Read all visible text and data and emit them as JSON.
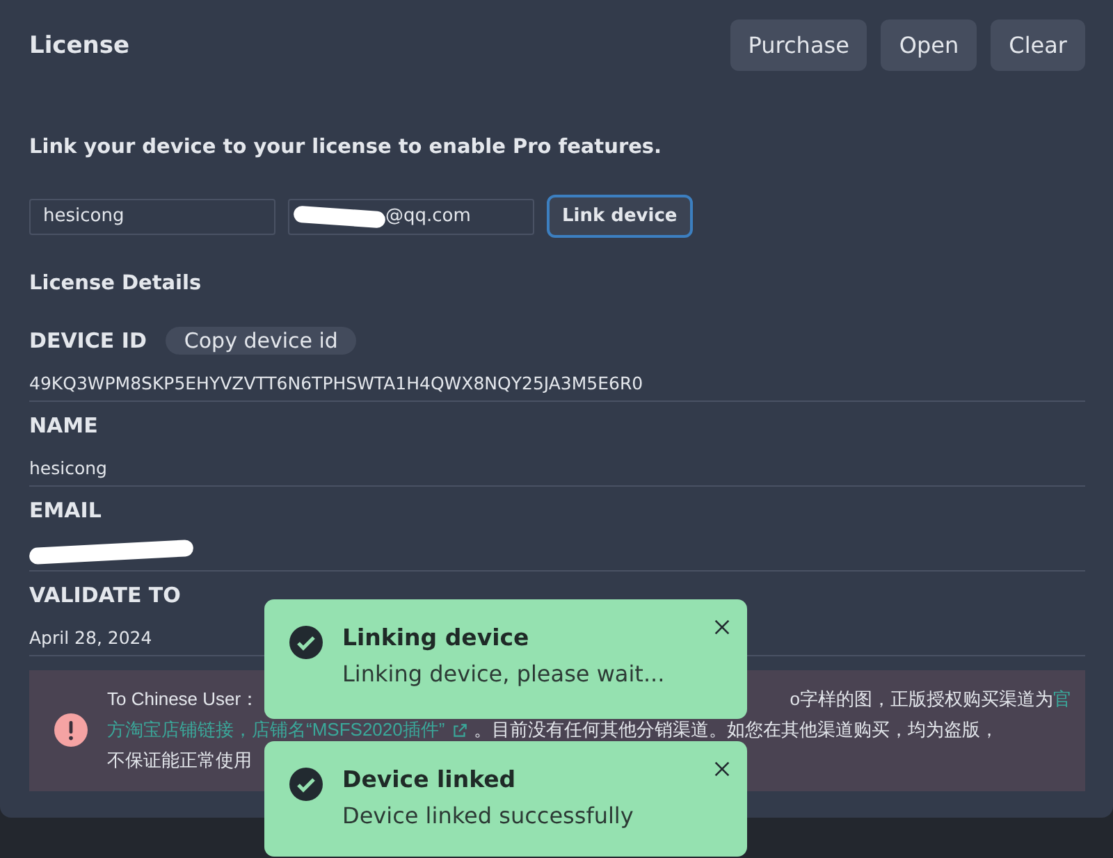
{
  "header": {
    "title": "License",
    "buttons": [
      "Purchase",
      "Open",
      "Clear"
    ]
  },
  "link_form": {
    "prompt": "Link your device to your license to enable Pro features.",
    "name_field": {
      "value": "hesicong"
    },
    "email_field": {
      "value": "@qq.com",
      "redacted": true
    },
    "button": {
      "label": "Link device",
      "focused": true
    }
  },
  "details": {
    "title": "License Details",
    "rows": [
      {
        "label": "DEVICE ID",
        "action": "Copy device id",
        "value": "49KQ3WPM8SKP5EHYVZVTT6N6TPHSWTA1H4QWX8NQY25JA3M5E6R0",
        "redacted": false
      },
      {
        "label": "NAME",
        "value": "hesicong",
        "redacted": false
      },
      {
        "label": "EMAIL",
        "redacted": true
      },
      {
        "label": "VALIDATE TO",
        "value": "April 28, 2024",
        "redacted": false
      }
    ]
  },
  "alert": {
    "lines": [
      {
        "left": [
          {
            "kind": "text",
            "text": "To Chinese User："
          }
        ],
        "right": [
          {
            "kind": "text",
            "text": "o字样的图，正版授权购买渠道为"
          },
          {
            "kind": "link",
            "text": "官"
          }
        ]
      },
      {
        "left": [
          {
            "kind": "link_external",
            "text": "方淘宝店铺链接，店铺名“MSFS2020插件”"
          },
          {
            "kind": "text",
            "text": "。目前没有任何其他分销渠道。如您在其他渠道购买，均为盗版，"
          }
        ]
      },
      {
        "left": [
          {
            "kind": "text",
            "text": "不保证能正常使用"
          }
        ]
      }
    ]
  },
  "toasts": [
    {
      "title": "Linking device",
      "message": "Linking device, please wait..."
    },
    {
      "title": "Device linked",
      "message": "Device linked successfully"
    }
  ]
}
